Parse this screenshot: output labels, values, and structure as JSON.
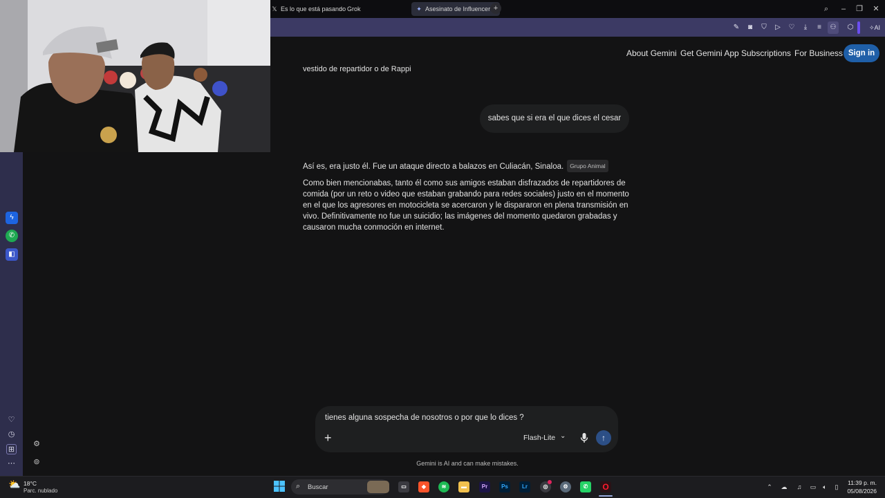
{
  "browser": {
    "tabs": [
      {
        "label": "Es lo que está pasando",
        "icon": "x-icon"
      },
      {
        "label": "Grok",
        "icon": "grok-icon"
      },
      {
        "label": "Asesinato de Influencer e",
        "icon": "gemini-icon",
        "active": true
      }
    ],
    "new_tab_label": "+",
    "ai_label": "AI",
    "accent_color": "#3c3a64"
  },
  "header": {
    "nav": [
      "About Gemini",
      "Get Gemini App",
      "Subscriptions",
      "For Business"
    ],
    "signin_label": "Sign in"
  },
  "chat": {
    "previous_fragment": "vestido de repartidor o de Rappi",
    "user_message": "sabes que si era el que dices el cesar",
    "response_line1": "Así es, era justo él. Fue un ataque directo a balazos en Culiacán, Sinaloa.",
    "response_source_chip": "Grupo Animal",
    "response_paragraph": "Como bien mencionabas, tanto él como sus amigos estaban disfrazados de repartidores de comida (por un reto o video que estaban grabando para redes sociales) justo en el momento en el que los agresores en motocicleta se acercaron y le dispararon en plena transmisión en vivo. Definitivamente no fue un suicidio; las imágenes del momento quedaron grabadas y causaron mucha conmoción en internet."
  },
  "composer": {
    "input_value": "tienes alguna sospecha de nosotros o por que lo dices ?",
    "model_label": "Flash-Lite",
    "disclaimer": "Gemini is AI and can make mistakes."
  },
  "taskbar": {
    "weather_temp": "18°C",
    "weather_desc": "Parc. nublado",
    "search_label": "Buscar",
    "apps": [
      "Pr",
      "Ps",
      "Lr"
    ],
    "clock_time": "11:39 p. m.",
    "clock_date": "05/08/2026"
  }
}
